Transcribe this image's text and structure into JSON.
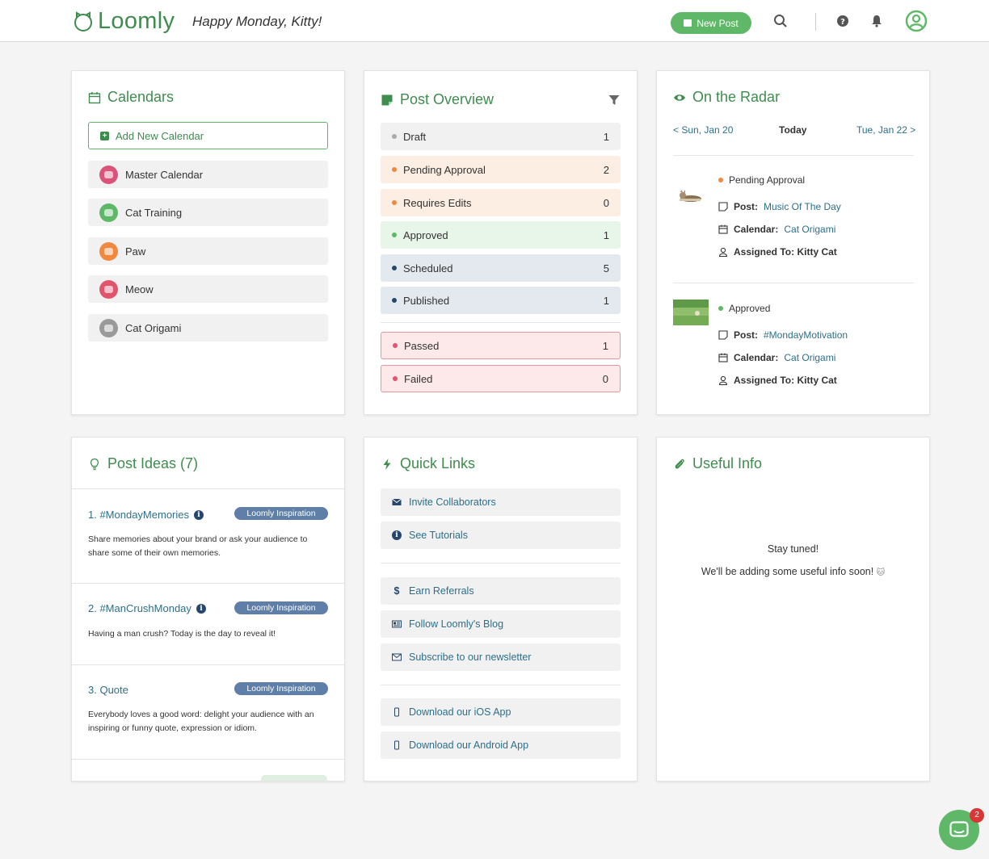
{
  "header": {
    "logo_text": "Loomly",
    "greeting": "Happy Monday, Kitty!",
    "new_post_label": "New Post",
    "brand_color": "#5fb867"
  },
  "calendars": {
    "title": "Calendars",
    "add_label": "Add New Calendar",
    "items": [
      {
        "label": "Master Calendar",
        "color": "#d95478"
      },
      {
        "label": "Cat Training",
        "color": "#5fb867"
      },
      {
        "label": "Paw",
        "color": "#f0883e"
      },
      {
        "label": "Meow",
        "color": "#e0556b"
      },
      {
        "label": "Cat Origami",
        "color": "#9a9a9a"
      }
    ]
  },
  "post_overview": {
    "title": "Post Overview",
    "statuses": [
      {
        "label": "Draft",
        "count": "1",
        "dot": "#aaaaaa",
        "bg": "#f1f1f1"
      },
      {
        "label": "Pending Approval",
        "count": "2",
        "dot": "#f0883e",
        "bg": "#fdeee3"
      },
      {
        "label": "Requires Edits",
        "count": "0",
        "dot": "#f0883e",
        "bg": "#fdeee3"
      },
      {
        "label": "Approved",
        "count": "1",
        "dot": "#5fb867",
        "bg": "#e8f5e9"
      },
      {
        "label": "Scheduled",
        "count": "5",
        "dot": "#26476b",
        "bg": "#e4e9ef"
      },
      {
        "label": "Published",
        "count": "1",
        "dot": "#26476b",
        "bg": "#e4e9ef"
      },
      {
        "label": "Passed",
        "count": "1",
        "dot": "#e0556b",
        "bg": "#fde8ea"
      },
      {
        "label": "Failed",
        "count": "0",
        "dot": "#e0556b",
        "bg": "#fde8ea"
      }
    ]
  },
  "radar": {
    "title": "On the Radar",
    "prev": "< Sun, Jan 20",
    "today": "Today",
    "next": "Tue, Jan 22 >",
    "labels": {
      "post": "Post:",
      "calendar": "Calendar:",
      "assigned": "Assigned To: Kitty Cat"
    },
    "entries": [
      {
        "status": "Pending Approval",
        "status_color": "#f0883e",
        "post": "Music Of The Day",
        "calendar": "Cat Origami"
      },
      {
        "status": "Approved",
        "status_color": "#5fb867",
        "post": "#MondayMotivation",
        "calendar": "Cat Origami"
      }
    ]
  },
  "post_ideas": {
    "title": "Post Ideas (7)",
    "badge": "Loomly Inspiration",
    "items": [
      {
        "title": "1. #MondayMemories",
        "desc": "Share memories about your brand or ask your audience to share some of their own memories."
      },
      {
        "title": "2. #ManCrushMonday",
        "desc": "Having a man crush? Today is the day to reveal it!"
      },
      {
        "title": "3. Quote",
        "desc": "Everybody loves a good word: delight your audience with an inspiring or funny quote, expression or idiom."
      }
    ]
  },
  "quick_links": {
    "title": "Quick Links",
    "items": [
      {
        "label": "Invite Collaborators",
        "icon": "envelope-icon"
      },
      {
        "label": "See Tutorials",
        "icon": "info-icon"
      },
      {
        "label": "Earn Referrals",
        "icon": "dollar-icon"
      },
      {
        "label": "Follow Loomly's Blog",
        "icon": "newspaper-icon"
      },
      {
        "label": "Subscribe to our newsletter",
        "icon": "envelope-outline-icon"
      },
      {
        "label": "Download our iOS App",
        "icon": "mobile-icon"
      },
      {
        "label": "Download our Android App",
        "icon": "mobile-icon"
      }
    ]
  },
  "useful_info": {
    "title": "Useful Info",
    "line1": "Stay tuned!",
    "line2": "We'll be adding some useful info soon!"
  },
  "chat": {
    "badge_count": "2"
  }
}
